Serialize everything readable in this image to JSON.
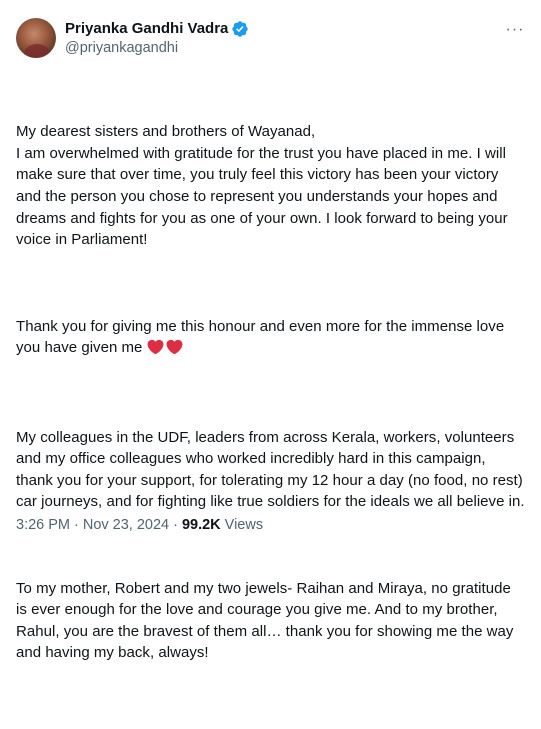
{
  "author": {
    "display_name": "Priyanka Gandhi Vadra",
    "handle": "@priyankagandhi",
    "verified": true,
    "verified_color": "#1d9bf0"
  },
  "menu": {
    "more_icon": "more-horizontal-icon",
    "more_glyph": "···"
  },
  "post": {
    "paragraphs": [
      "My dearest sisters and brothers of Wayanad,\nI am overwhelmed with gratitude for the trust you have placed in me. I will make sure that over time, you truly feel this victory has been your victory and the person you chose to represent you understands your hopes and dreams and fights for you as one of your own. I look forward to being your voice in Parliament!",
      "Thank you for giving me this honour and even more for the immense love you have given me",
      "My colleagues in the UDF, leaders from across Kerala, workers, volunteers and my office colleagues who worked incredibly hard in this campaign, thank you for your support, for tolerating my 12 hour a day (no food, no rest) car journeys, and for fighting like true soldiers for the ideals we all believe in.",
      "To my mother, Robert and my two jewels- Raihan and Miraya, no gratitude is ever enough for the love and courage you give me. And to my brother, Rahul, you are the bravest of them all… thank you for showing me the way and having my back, always!"
    ],
    "emoji": [
      "red-heart-icon",
      "red-heart-icon"
    ],
    "heart_color": "#dd2e44"
  },
  "meta": {
    "time": "3:26 PM",
    "separator": "·",
    "date": "Nov 23, 2024",
    "views_count": "99.2K",
    "views_label": "Views"
  },
  "colors": {
    "text_primary": "#0f1419",
    "text_secondary": "#536471",
    "background": "#ffffff"
  }
}
